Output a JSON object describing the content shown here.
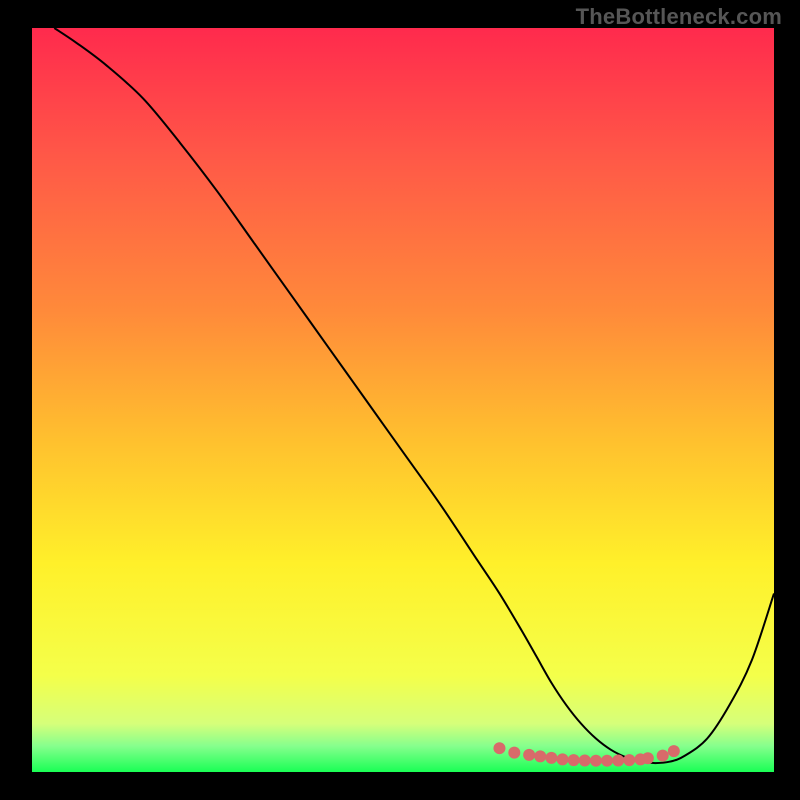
{
  "watermark": "TheBottleneck.com",
  "colors": {
    "frame_bg": "#000000",
    "curve_stroke": "#000000",
    "marker_fill": "#d86a6a",
    "gradient_stops": [
      {
        "offset": 0.0,
        "color": "#ff2a4d"
      },
      {
        "offset": 0.18,
        "color": "#ff5a47"
      },
      {
        "offset": 0.38,
        "color": "#ff8a3a"
      },
      {
        "offset": 0.56,
        "color": "#ffc22e"
      },
      {
        "offset": 0.72,
        "color": "#fff02a"
      },
      {
        "offset": 0.87,
        "color": "#f4ff4a"
      },
      {
        "offset": 0.935,
        "color": "#d6ff7a"
      },
      {
        "offset": 0.965,
        "color": "#86ff8d"
      },
      {
        "offset": 1.0,
        "color": "#1aff55"
      }
    ]
  },
  "chart_data": {
    "type": "line",
    "title": "",
    "xlabel": "",
    "ylabel": "",
    "xlim": [
      0,
      100
    ],
    "ylim": [
      0,
      100
    ],
    "grid": false,
    "legend": false,
    "series": [
      {
        "name": "curve",
        "x": [
          3,
          6,
          10,
          15,
          20,
          25,
          30,
          35,
          40,
          45,
          50,
          55,
          60,
          63,
          66,
          68,
          70,
          72,
          74,
          76,
          78,
          80,
          82,
          84,
          86,
          88,
          91,
          94,
          97,
          100
        ],
        "values": [
          100,
          98,
          95,
          90.5,
          84.5,
          78,
          71,
          64,
          57,
          50,
          43,
          36,
          28.5,
          24,
          19,
          15.5,
          12,
          9,
          6.5,
          4.5,
          3,
          2,
          1.4,
          1.2,
          1.4,
          2.2,
          4.5,
          9,
          15,
          24
        ]
      }
    ],
    "markers": {
      "name": "highlighted-points",
      "x": [
        63,
        65,
        67,
        68.5,
        70,
        71.5,
        73,
        74.5,
        76,
        77.5,
        79,
        80.5,
        82,
        83,
        85,
        86.5
      ],
      "values": [
        3.2,
        2.6,
        2.3,
        2.1,
        1.9,
        1.7,
        1.6,
        1.55,
        1.52,
        1.52,
        1.55,
        1.6,
        1.7,
        1.85,
        2.2,
        2.8
      ]
    }
  }
}
